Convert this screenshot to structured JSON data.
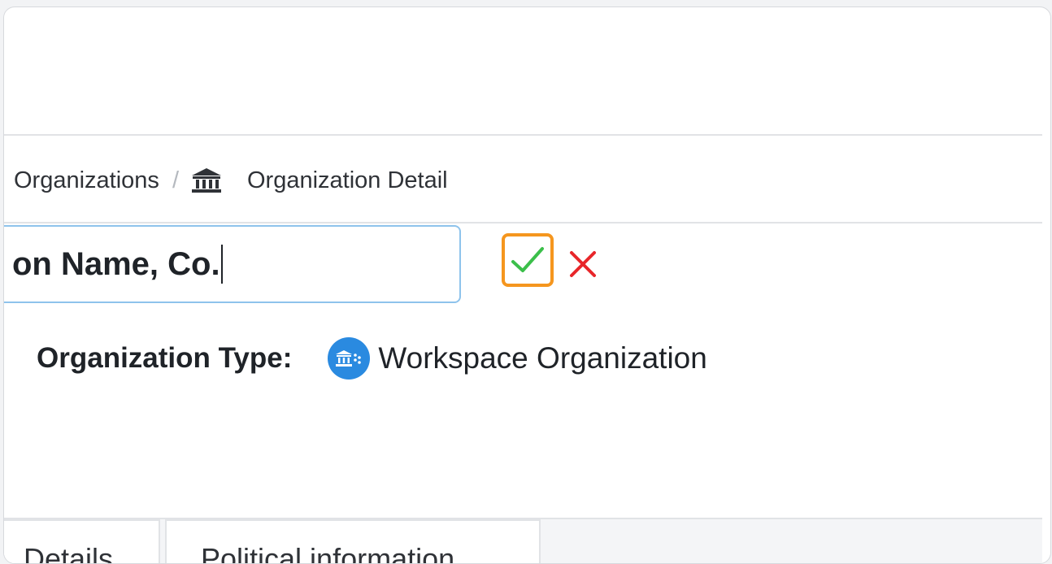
{
  "breadcrumb": {
    "parent": "Organizations",
    "separator": "/",
    "current": "Organization Detail",
    "current_icon": "bank-icon"
  },
  "name_field": {
    "value": "on Name, Co."
  },
  "actions": {
    "confirm_icon": "checkmark-icon",
    "cancel_icon": "close-icon",
    "colors": {
      "confirm_border": "#f5961e",
      "confirm_check": "#3bbf4a",
      "cancel": "#e8262a"
    }
  },
  "organization_type": {
    "label": "Organization Type:",
    "value": "Workspace Organization",
    "icon": "workspace-organization-icon",
    "icon_color": "#2a8ae0"
  },
  "tabs": [
    {
      "label": "Details"
    },
    {
      "label": "Political information"
    }
  ]
}
